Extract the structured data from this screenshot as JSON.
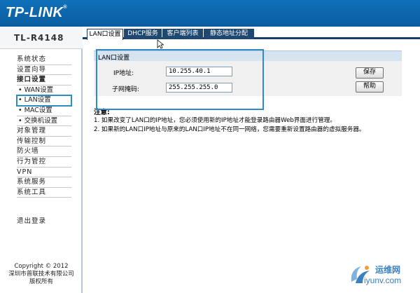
{
  "header": {
    "brand": "TP-LINK",
    "reg": "®"
  },
  "model": "TL-R4148",
  "tabs": [
    {
      "label": "LAN口设置",
      "active": true
    },
    {
      "label": "DHCP服务",
      "active": false
    },
    {
      "label": "客户端列表",
      "active": false
    },
    {
      "label": "静态地址分配",
      "active": false
    }
  ],
  "sidebar": {
    "items": [
      {
        "label": "系统状态"
      },
      {
        "label": "设置向导"
      },
      {
        "label": "接口设置"
      },
      {
        "label": "• WAN设置"
      },
      {
        "label": "• LAN设置"
      },
      {
        "label": "• MAC设置"
      },
      {
        "label": "• 交换机设置"
      },
      {
        "label": "对象管理"
      },
      {
        "label": "传输控制"
      },
      {
        "label": "防火墙"
      },
      {
        "label": "行为管控"
      },
      {
        "label": "VPN"
      },
      {
        "label": "系统服务"
      },
      {
        "label": "系统工具"
      }
    ],
    "logout": "退出登录",
    "copyright": [
      "Copyright © 2012",
      "深圳市普联技术有限公司",
      "版权所有"
    ]
  },
  "section": {
    "title": "LAN口设置"
  },
  "form": {
    "ip_label": "IP地址:",
    "ip_value": "10.255.40.1",
    "mask_label": "子网掩码:",
    "mask_value": "255.255.255.0",
    "save": "保存",
    "help": "帮助"
  },
  "notes": {
    "title": "注意:",
    "lines": [
      "1. 如果改变了LAN口的IP地址，您必须使用新的IP地址才能登录路由器Web界面进行管理。",
      "2. 如果新的LAN口IP地址与原来的LAN口IP地址不在同一网络，您需要重新设置路由器的虚拟服务器。"
    ]
  },
  "watermark": {
    "name": "运维网",
    "url": "iyunv.com"
  },
  "colors": {
    "header": "#0f70b9",
    "tab_dark": "#1f4870",
    "highlight": "#2f8ac8",
    "section_bar": "#d6e4f2"
  }
}
